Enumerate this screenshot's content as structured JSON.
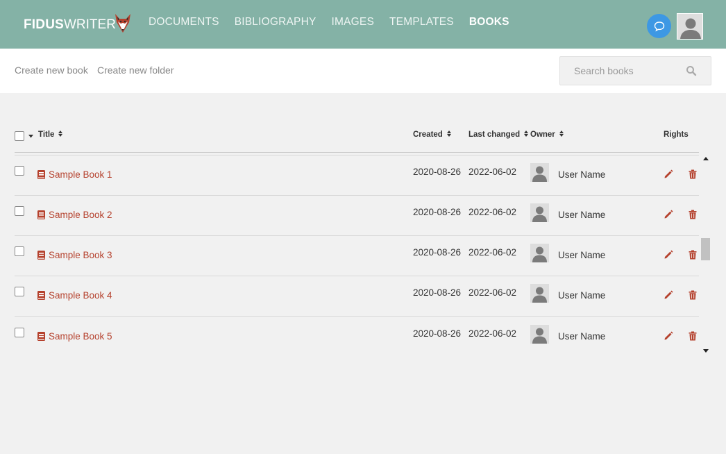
{
  "brand": {
    "bold": "FIDUS",
    "light": "WRITER"
  },
  "nav": [
    {
      "label": "DOCUMENTS",
      "active": false
    },
    {
      "label": "BIBLIOGRAPHY",
      "active": false
    },
    {
      "label": "IMAGES",
      "active": false
    },
    {
      "label": "TEMPLATES",
      "active": false
    },
    {
      "label": "BOOKS",
      "active": true
    }
  ],
  "toolbar": {
    "create_book": "Create new book",
    "create_folder": "Create new folder",
    "search_placeholder": "Search books"
  },
  "table": {
    "headers": {
      "title": "Title",
      "created": "Created",
      "last_changed": "Last changed",
      "owner": "Owner",
      "rights": "Rights"
    },
    "rows": [
      {
        "title": "Sample Book 1",
        "created": "2020-08-26",
        "last_changed": "2022-06-02",
        "owner": "User Name"
      },
      {
        "title": "Sample Book 2",
        "created": "2020-08-26",
        "last_changed": "2022-06-02",
        "owner": "User Name"
      },
      {
        "title": "Sample Book 3",
        "created": "2020-08-26",
        "last_changed": "2022-06-02",
        "owner": "User Name"
      },
      {
        "title": "Sample Book 4",
        "created": "2020-08-26",
        "last_changed": "2022-06-02",
        "owner": "User Name"
      },
      {
        "title": "Sample Book 5",
        "created": "2020-08-26",
        "last_changed": "2022-06-02",
        "owner": "User Name"
      }
    ]
  },
  "colors": {
    "header_bg": "#84b2a6",
    "link": "#b5412d",
    "chat_button": "#3d98e4",
    "page_bg": "#f1f1f1"
  },
  "icons": {
    "logo": "fox-logo-icon",
    "chat": "chat-bubble-icon",
    "search": "search-icon",
    "book": "book-icon",
    "edit": "pencil-icon",
    "delete": "trash-icon",
    "user": "user-avatar-icon"
  }
}
